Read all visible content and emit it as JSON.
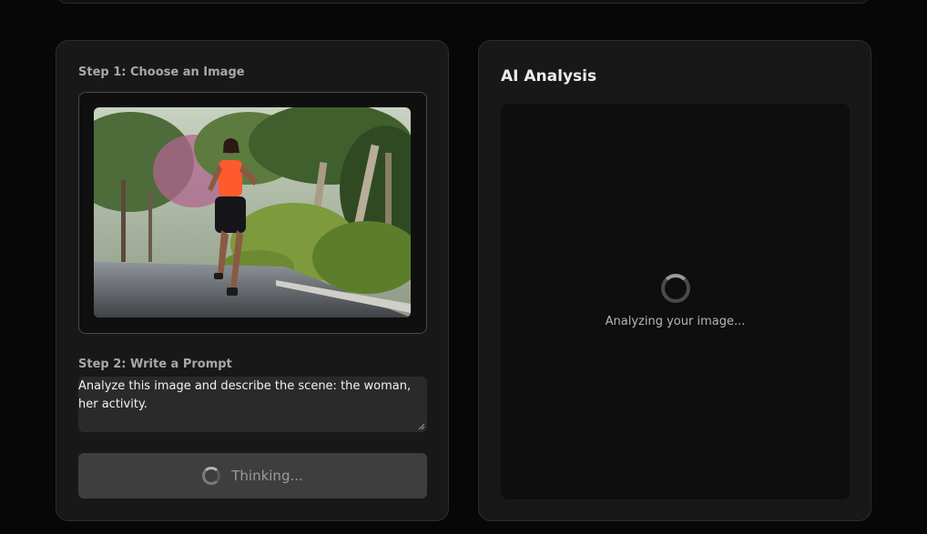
{
  "left_panel": {
    "step1_label": "Step 1: Choose an Image",
    "step2_label": "Step 2: Write a Prompt",
    "prompt_value": "Analyze this image and describe the scene: the woman, her activity.",
    "submit_label": "Thinking..."
  },
  "right_panel": {
    "title": "AI Analysis",
    "status": "Analyzing your image..."
  },
  "icons": {
    "button_spinner": "spinner-icon",
    "loading_spinner": "loading-spinner-icon"
  },
  "colors": {
    "page_bg": "#070707",
    "panel_bg": "#181818",
    "result_bg": "#0e0e0e",
    "button_bg": "#3e3e3e"
  }
}
